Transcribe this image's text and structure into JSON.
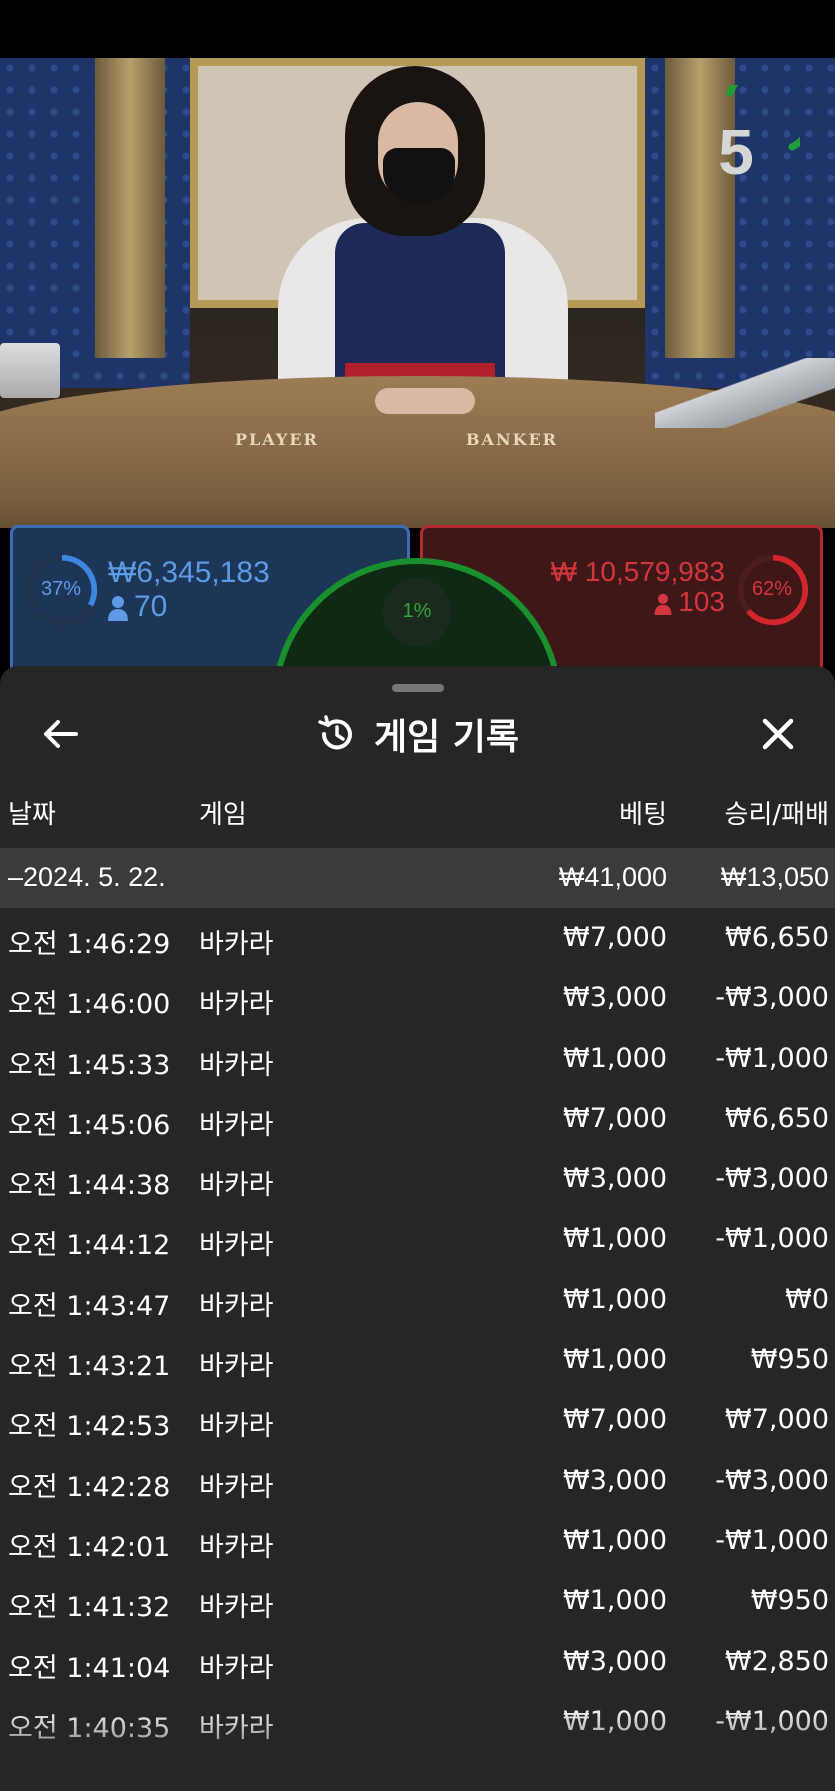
{
  "video": {
    "countdown": "5",
    "table_labels": {
      "player": "PLAYER",
      "banker": "BANKER"
    }
  },
  "betting": {
    "player": {
      "percent": "37%",
      "amount": "₩6,345,183",
      "count": "70"
    },
    "tie": {
      "percent": "1%"
    },
    "banker": {
      "percent": "62%",
      "amount": "₩ 10,579,983",
      "count": "103"
    }
  },
  "colors": {
    "player": "#5e9be4",
    "banker": "#d2373d",
    "tie": "#2fa442",
    "sheet_bg": "#262626",
    "summary_bg": "#3b3b3b"
  },
  "history": {
    "title": "게임 기록",
    "icons": {
      "back": "arrow-left-icon",
      "title": "history-icon",
      "close": "close-icon"
    },
    "columns": {
      "date": "날짜",
      "game": "게임",
      "bet": "베팅",
      "result": "승리/패배"
    },
    "summary": {
      "date": "–2024. 5. 22.",
      "bet": "₩41,000",
      "result": "₩13,050"
    },
    "rows": [
      {
        "time": "오전 1:46:29",
        "game": "바카라",
        "bet": "₩7,000",
        "result": "₩6,650"
      },
      {
        "time": "오전 1:46:00",
        "game": "바카라",
        "bet": "₩3,000",
        "result": "-₩3,000"
      },
      {
        "time": "오전 1:45:33",
        "game": "바카라",
        "bet": "₩1,000",
        "result": "-₩1,000"
      },
      {
        "time": "오전 1:45:06",
        "game": "바카라",
        "bet": "₩7,000",
        "result": "₩6,650"
      },
      {
        "time": "오전 1:44:38",
        "game": "바카라",
        "bet": "₩3,000",
        "result": "-₩3,000"
      },
      {
        "time": "오전 1:44:12",
        "game": "바카라",
        "bet": "₩1,000",
        "result": "-₩1,000"
      },
      {
        "time": "오전 1:43:47",
        "game": "바카라",
        "bet": "₩1,000",
        "result": "₩0"
      },
      {
        "time": "오전 1:43:21",
        "game": "바카라",
        "bet": "₩1,000",
        "result": "₩950"
      },
      {
        "time": "오전 1:42:53",
        "game": "바카라",
        "bet": "₩7,000",
        "result": "₩7,000"
      },
      {
        "time": "오전 1:42:28",
        "game": "바카라",
        "bet": "₩3,000",
        "result": "-₩3,000"
      },
      {
        "time": "오전 1:42:01",
        "game": "바카라",
        "bet": "₩1,000",
        "result": "-₩1,000"
      },
      {
        "time": "오전 1:41:32",
        "game": "바카라",
        "bet": "₩1,000",
        "result": "₩950"
      },
      {
        "time": "오전 1:41:04",
        "game": "바카라",
        "bet": "₩3,000",
        "result": "₩2,850"
      },
      {
        "time": "오전 1:40:35",
        "game": "바카라",
        "bet": "₩1,000",
        "result": "-₩1,000"
      }
    ]
  }
}
